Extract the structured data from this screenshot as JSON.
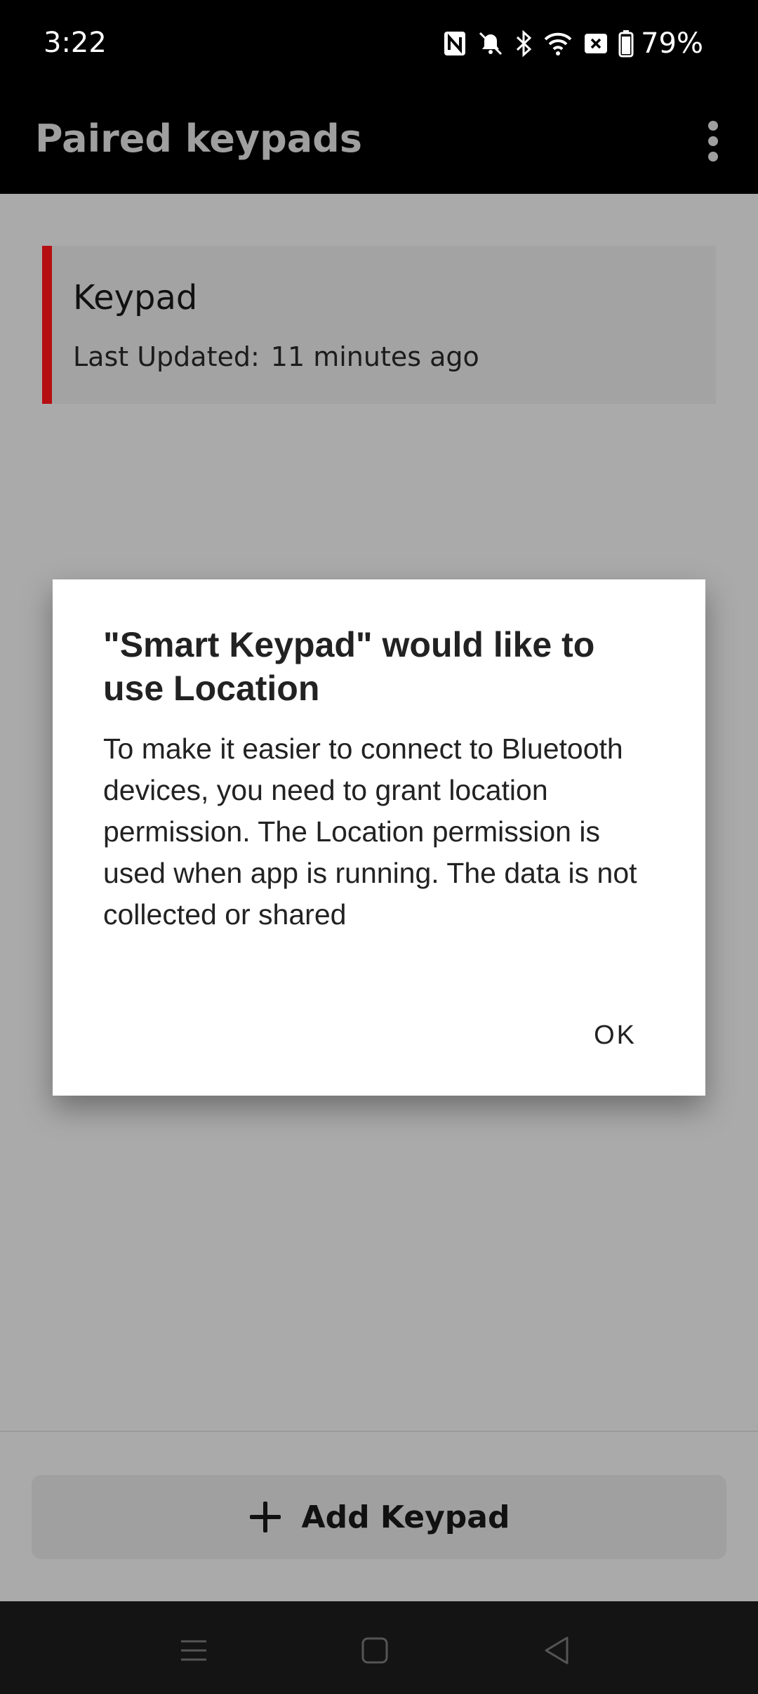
{
  "status_bar": {
    "time": "3:22",
    "battery": "79%",
    "icons": [
      "nfc-icon",
      "mute-icon",
      "bluetooth-icon",
      "wifi-icon",
      "no-sim-icon",
      "battery-icon"
    ]
  },
  "app_bar": {
    "title": "Paired keypads",
    "menu_icon": "more-vert-icon"
  },
  "keypads": [
    {
      "name": "Keypad",
      "last_updated_label": "Last Updated:",
      "last_updated_value": "11 minutes ago",
      "accent_color": "#b50f12"
    }
  ],
  "dialog": {
    "title": "\"Smart Keypad\" would like to use Location",
    "body": "To make it easier to connect to Bluetooth devices, you need to grant location permission. The Location permission is used when app is running. The data is not collected or shared",
    "ok_label": "OK"
  },
  "footer": {
    "add_label": "Add Keypad"
  },
  "nav_bar": {
    "icons": [
      "recent-apps-icon",
      "home-icon",
      "back-icon"
    ]
  }
}
